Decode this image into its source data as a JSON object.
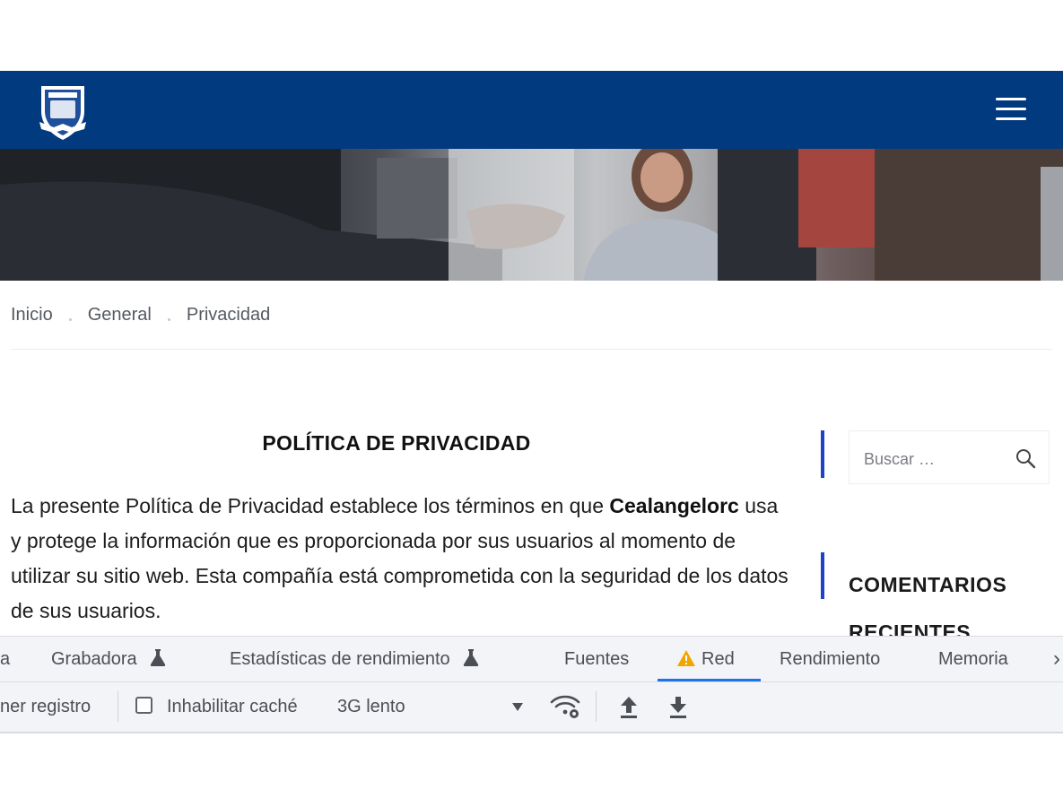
{
  "header": {
    "logo_icon": "school-crest-logo",
    "menu_icon": "hamburger-menu-icon",
    "background_color": "#023a7f"
  },
  "breadcrumb": {
    "items": [
      "Inicio",
      "General",
      "Privacidad"
    ]
  },
  "article": {
    "title": "POLÍTICA DE PRIVACIDAD",
    "body_part1": "La presente Política de Privacidad establece los términos en que ",
    "company": "Cealangelorc",
    "body_part2": " usa y protege la información que es proporcionada por sus usuarios al momento de utilizar su sitio web. Esta compañía está comprometida con la seguridad de los datos de sus usuarios."
  },
  "sidebar": {
    "search_placeholder": "Buscar …",
    "recent_comments_line1": "COMENTARIOS",
    "recent_comments_line2": "RECIENTES",
    "accent_color": "#1e43c8"
  },
  "devtools": {
    "tabs": {
      "partial": "a",
      "recorder": "Grabadora",
      "performance_insights": "Estadísticas de rendimiento",
      "sources": "Fuentes",
      "network": "Red",
      "performance": "Rendimiento",
      "memory": "Memoria",
      "more": "›"
    },
    "active_tab": "Red",
    "active_color": "#1a73e8",
    "toolbar": {
      "preserve_log_partial": "ner registro",
      "disable_cache_label": "Inhabilitar caché",
      "disable_cache_checked": false,
      "throttling_value": "3G lento"
    }
  }
}
